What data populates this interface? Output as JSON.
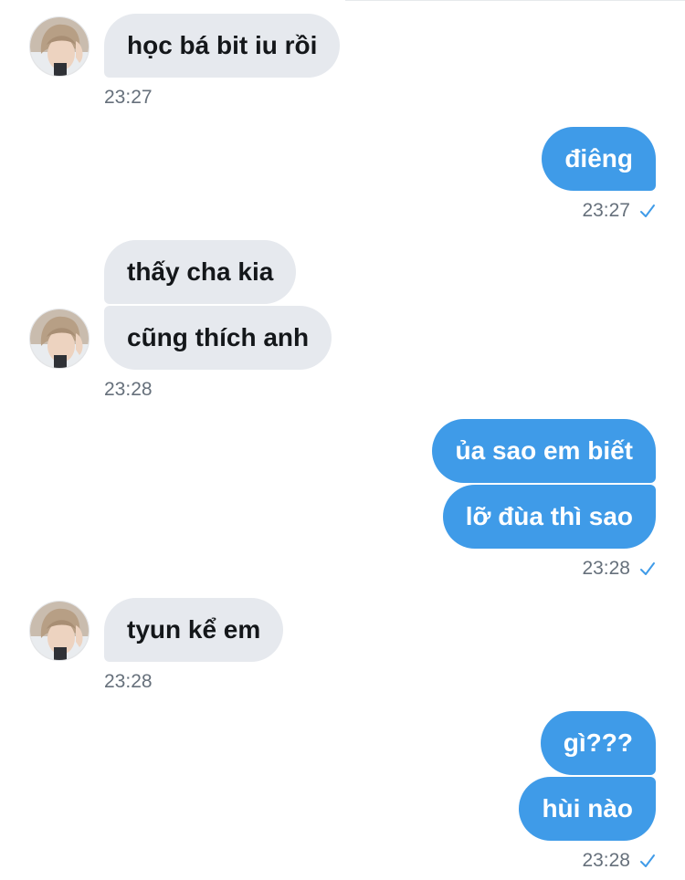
{
  "conversation": {
    "messages": [
      {
        "id": 1,
        "side": "in",
        "text": "học bá bit iu rồi"
      },
      {
        "id": 2,
        "side": "out",
        "text": "điêng"
      },
      {
        "id": 3,
        "side": "in",
        "text": "thấy cha kia"
      },
      {
        "id": 4,
        "side": "in",
        "text": "cũng thích anh"
      },
      {
        "id": 5,
        "side": "out",
        "text": "ủa sao em biết"
      },
      {
        "id": 6,
        "side": "out",
        "text": "lỡ đùa thì sao"
      },
      {
        "id": 7,
        "side": "in",
        "text": "tyun kể em"
      },
      {
        "id": 8,
        "side": "out",
        "text": "gì???"
      },
      {
        "id": 9,
        "side": "out",
        "text": "hùi nào"
      }
    ],
    "timestamps": [
      "23:27",
      "23:27",
      "23:28",
      "23:28",
      "23:28",
      "23:28"
    ]
  },
  "icons": {
    "avatar": "contact-avatar",
    "read_receipt": "check-icon"
  },
  "colors": {
    "incoming_bubble": "#e6e9ee",
    "outgoing_bubble": "#3f9be8",
    "timestamp": "#66707b",
    "check": "#3f9be8"
  }
}
